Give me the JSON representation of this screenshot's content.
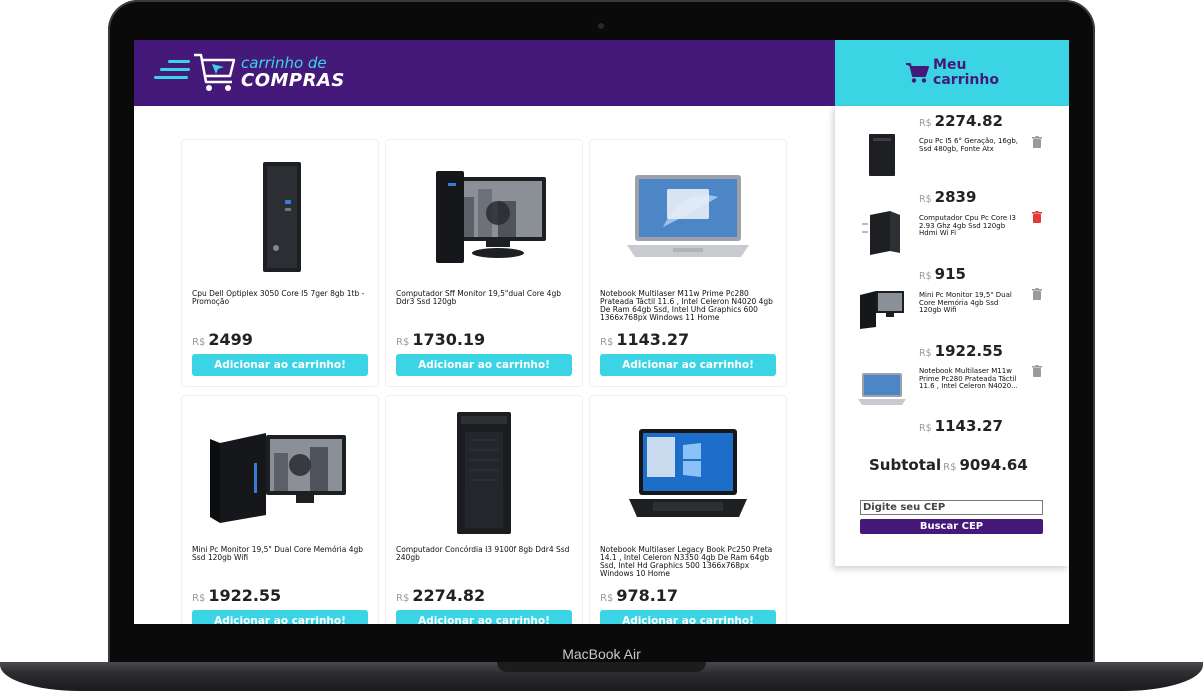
{
  "device": {
    "label": "MacBook Air"
  },
  "header": {
    "logo_top": "carrinho de",
    "logo_bottom": "COMPRAS"
  },
  "cart": {
    "title_line1": "Meu",
    "title_line2": "carrinho"
  },
  "currency": "R$",
  "products": [
    {
      "name": "Cpu Dell Optiplex 3050 Core I5 7ger 8gb 1tb - Promoção",
      "price": "2499",
      "button": "Adicionar ao carrinho!",
      "image": "desktop-tower"
    },
    {
      "name": "Computador Sff Monitor 19,5\"dual Core 4gb Ddr3 Ssd 120gb",
      "price": "1730.19",
      "button": "Adicionar ao carrinho!",
      "image": "desktop-with-monitor"
    },
    {
      "name": "Notebook Multilaser M11w Prime Pc280 Prateada Táctil 11.6 , Intel Celeron N4020 4gb De Ram 64gb Ssd, Intel Uhd Graphics 600 1366x768px Windows 11 Home",
      "price": "1143.27",
      "button": "Adicionar ao carrinho!",
      "image": "silver-laptop"
    },
    {
      "name": "Mini Pc Monitor 19,5\" Dual Core Memória 4gb Ssd 120gb Wifi",
      "price": "1922.55",
      "button": "Adicionar ao carrinho!",
      "image": "mini-pc-with-monitor"
    },
    {
      "name": "Computador Concórdia I3 9100f 8gb Ddr4 Ssd 240gb",
      "price": "2274.82",
      "button": "Adicionar ao carrinho!",
      "image": "tall-tower"
    },
    {
      "name": "Notebook Multilaser Legacy Book Pc250 Preta 14.1 , Intel Celeron N3350 4gb De Ram 64gb Ssd, Intel Hd Graphics 500 1366x768px Windows 10 Home",
      "price": "978.17",
      "button": "Adicionar ao carrinho!",
      "image": "black-laptop"
    }
  ],
  "cart_items": [
    {
      "price": "2274.82",
      "name": "Cpu Pc I5 6° Geração, 16gb, Ssd 480gb, Fonte Atx",
      "image": "small-tower",
      "trash_color": "#9a9a9a"
    },
    {
      "price": "2839",
      "name": "Computador Cpu Pc Core I3 2.93 Ghz 4gb Ssd 120gb Hdmi Wi Fi",
      "image": "tower-angled",
      "trash_color": "#e53935"
    },
    {
      "price": "915",
      "name": "Mini Pc Monitor 19,5\" Dual Core Memória 4gb Ssd 120gb Wifi",
      "image": "mini-pc-with-monitor",
      "trash_color": "#9a9a9a"
    },
    {
      "price": "1922.55",
      "name": "Notebook Multilaser M11w Prime Pc280 Prateada Táctil 11.6 , Intel Celeron N4020...",
      "image": "silver-laptop",
      "trash_color": "#9a9a9a"
    }
  ],
  "cart_trailing_price": "1143.27",
  "subtotal": {
    "label": "Subtotal",
    "value": "9094.64"
  },
  "cep": {
    "placeholder": "Digite seu CEP",
    "button": "Buscar CEP"
  },
  "colors": {
    "purple": "#45197a",
    "cyan": "#3bd4e5",
    "trash_active": "#e53935"
  }
}
